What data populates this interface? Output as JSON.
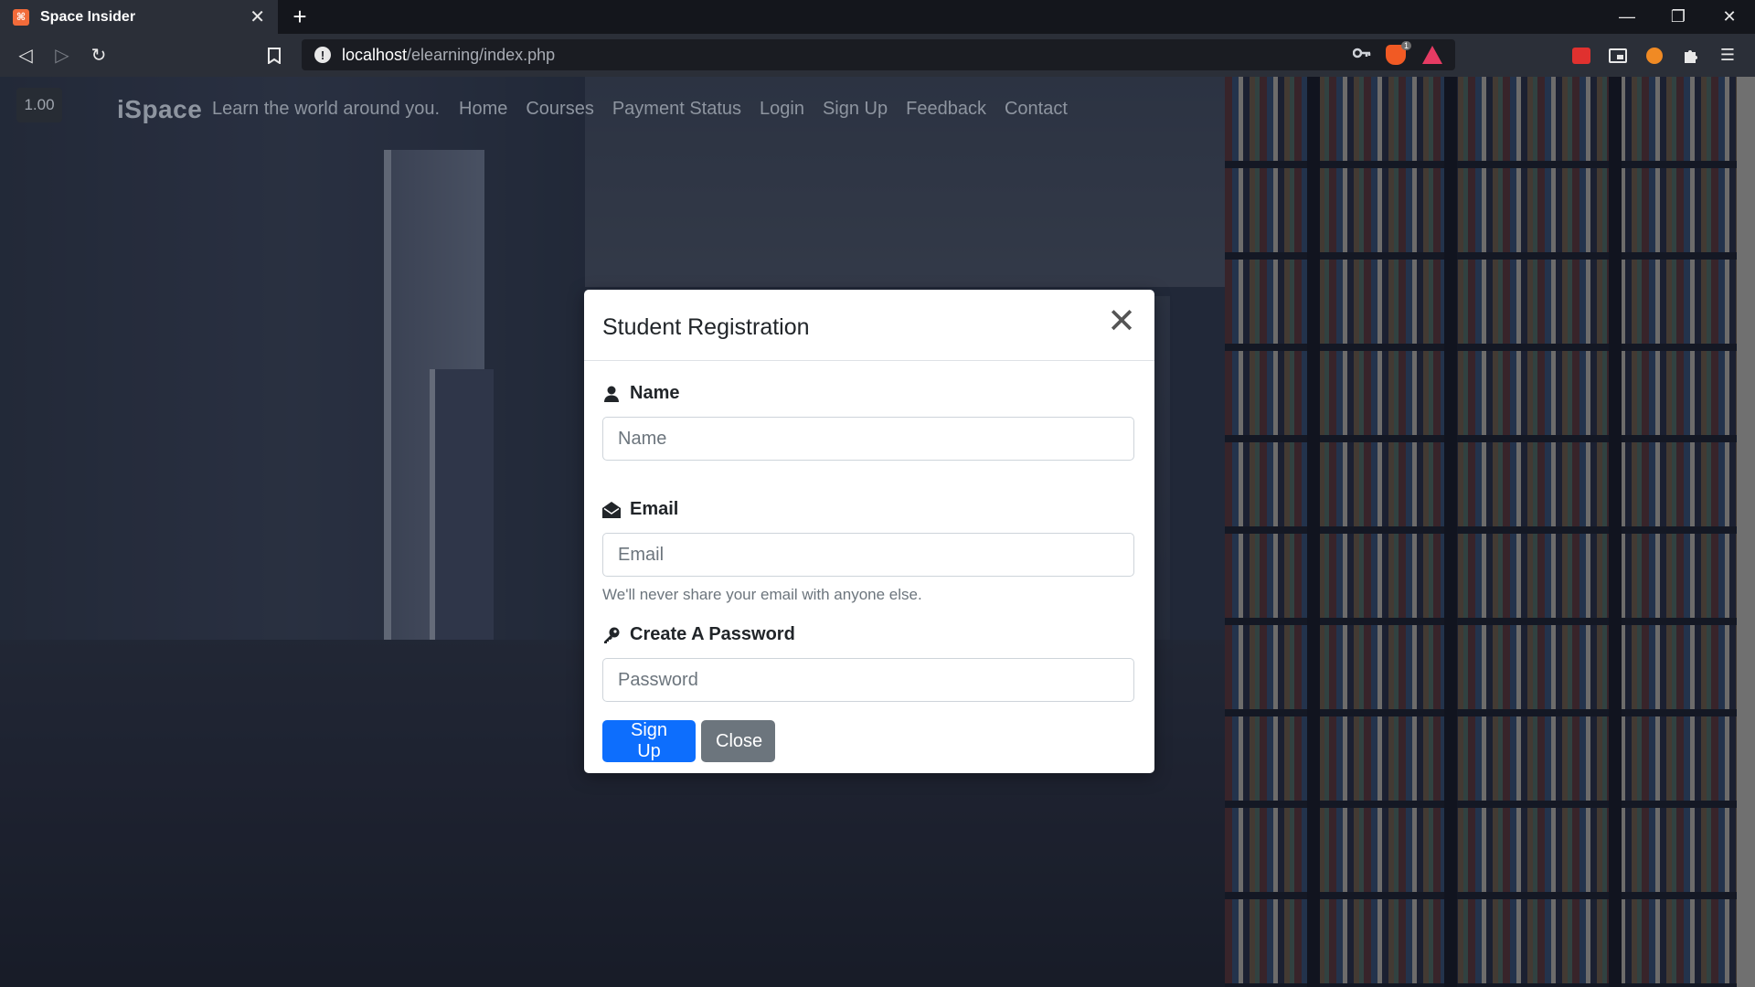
{
  "browser": {
    "tab_title": "Space Insider",
    "tab_favicon_glyph": "⌘",
    "url_host": "localhost",
    "url_path": "/elearning/index.php",
    "shield_badge": "1"
  },
  "site": {
    "zoom": "1.00",
    "brand": "iSpace",
    "tagline": "Learn the world around you.",
    "nav_links": [
      "Home",
      "Courses",
      "Payment Status",
      "Login",
      "Sign Up",
      "Feedback",
      "Contact"
    ]
  },
  "modal": {
    "title": "Student Registration",
    "name_label": "Name",
    "name_placeholder": "Name",
    "email_label": "Email",
    "email_placeholder": "Email",
    "email_help": "We'll never share your email with anyone else.",
    "password_label": "Create A Password",
    "password_placeholder": "Password",
    "signup_button": "Sign Up",
    "close_button": "Close"
  },
  "colors": {
    "primary": "#0d6efd",
    "secondary": "#6c757d",
    "brave_orange": "#f15a24"
  }
}
